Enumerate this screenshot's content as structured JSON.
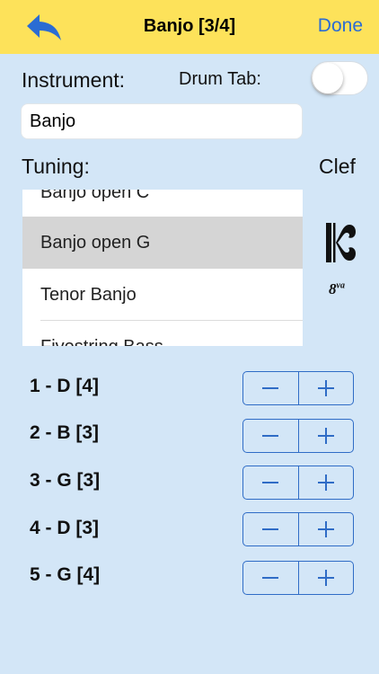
{
  "navbar": {
    "title": "Banjo [3/4]",
    "done_label": "Done"
  },
  "instrument": {
    "label": "Instrument:",
    "value": "Banjo"
  },
  "drum_tab": {
    "label": "Drum Tab:",
    "enabled": false
  },
  "tuning": {
    "label": "Tuning:",
    "options": [
      "Banjo open C",
      "Banjo open G",
      "Tenor Banjo",
      "Fivestring Bass"
    ],
    "selected": "Banjo open G"
  },
  "clef": {
    "label": "Clef",
    "octave_label": "8",
    "octave_sup": "va"
  },
  "strings": [
    {
      "label": "1 - D [4]"
    },
    {
      "label": "2 - B [3]"
    },
    {
      "label": "3 - G [3]"
    },
    {
      "label": "4 - D [3]"
    },
    {
      "label": "5 - G [4]"
    }
  ],
  "colors": {
    "nav_bg": "#fde25a",
    "page_bg": "#d3e6f7",
    "accent": "#2b6cd3"
  }
}
